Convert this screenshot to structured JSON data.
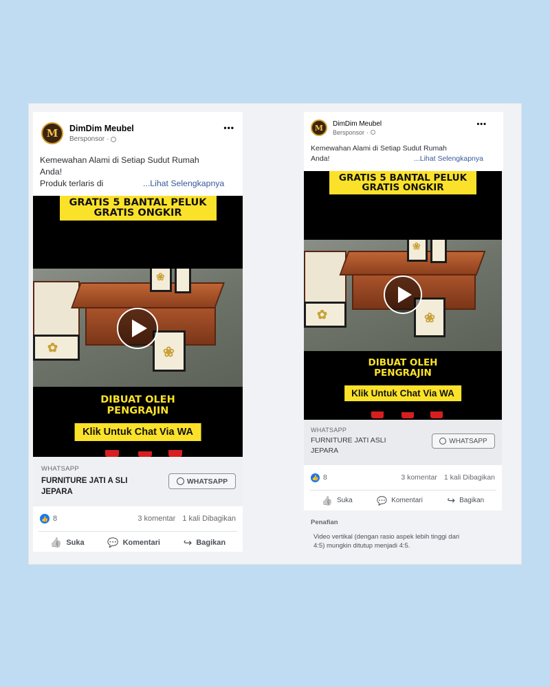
{
  "left": {
    "page_name": "DimDim Meubel",
    "sponsored": "Bersponsor",
    "text_line1": "Kemewahan Alami di Setiap Sudut Rumah",
    "text_line2": "Anda!",
    "text_line3": "Produk terlaris di",
    "see_more": "...Lihat Selengkapnya",
    "banner_line1": "GRATIS 5 BANTAL PELUK",
    "banner_line2": "GRATIS ONGKIR",
    "made_line1": "DIBUAT OLEH",
    "made_line2": "PENGRAJIN",
    "wa_banner": "Klik Untuk Chat Via WA",
    "cta_source": "WHATSAPP",
    "cta_title_line1": "FURNITURE JATI A SLI",
    "cta_title_line2": "JEPARA",
    "cta_button": "WHATSAPP",
    "likes": "8",
    "comments": "3 komentar",
    "shares": "1 kali Dibagikan",
    "like_label": "Suka",
    "comment_label": "Komentari",
    "share_label": "Bagikan"
  },
  "right": {
    "page_name": "DimDim Meubel",
    "sponsored": "Bersponsor",
    "text_line1": "Kemewahan Alami di Setiap Sudut Rumah",
    "text_line2": "Anda!",
    "see_more": "...Lihat Selengkapnya",
    "banner_line1": "GRATIS 5 BANTAL PELUK",
    "banner_line2": "GRATIS ONGKIR",
    "made_line1": "DIBUAT OLEH",
    "made_line2": "PENGRAJIN",
    "wa_banner": "Klik Untuk Chat Via WA",
    "cta_source": "WHATSAPP",
    "cta_title_line1": "FURNITURE JATI ASLI",
    "cta_title_line2": "JEPARA",
    "cta_button": "WHATSAPP",
    "likes": "8",
    "comments": "3 komentar",
    "shares": "1 kali Dibagikan",
    "like_label": "Suka",
    "comment_label": "Komentari",
    "share_label": "Bagikan",
    "disclaimer_title": "Penafian",
    "disclaimer_line1": "Video vertikal (dengan rasio aspek lebih tinggi dari",
    "disclaimer_line2": "4:5) mungkin ditutup menjadi 4:5."
  },
  "icons": {
    "avatar_letter": "M",
    "more": "•••",
    "like": "👍",
    "comment": "💬",
    "share": "↪"
  },
  "colors": {
    "background": "#bfdcf2",
    "banner_yellow": "#fbe22a",
    "facebook_blue": "#1877f2",
    "link_blue": "#385898"
  }
}
